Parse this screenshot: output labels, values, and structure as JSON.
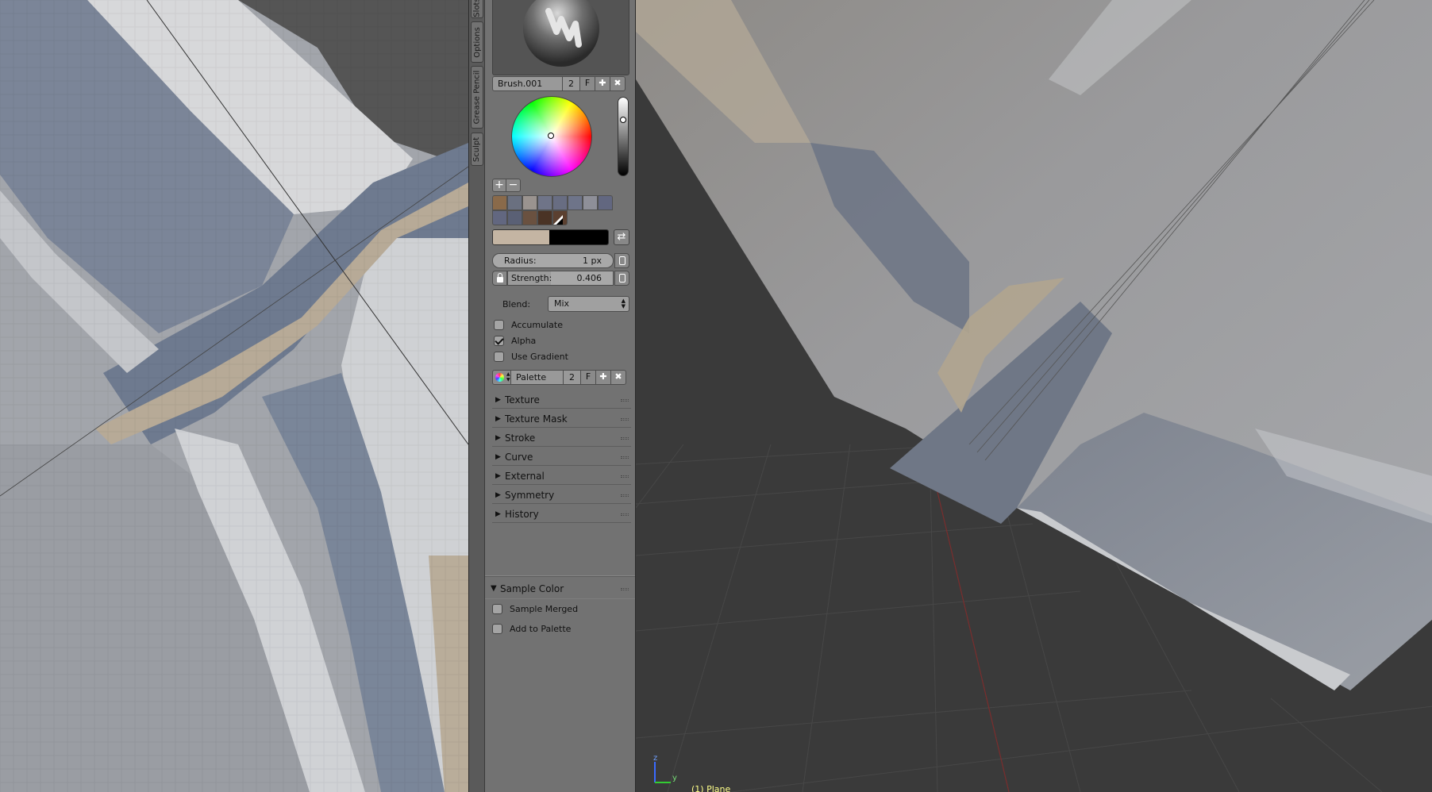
{
  "shelf_tabs": [
    "Slots",
    "Options",
    "Grease Pencil",
    "Sculpt"
  ],
  "brush": {
    "name": "Brush.001",
    "users": "2",
    "fake_user": "F"
  },
  "palette_colors": [
    [
      "#8a6a4a",
      "#6a7080",
      "#9a938f",
      "#6f7488",
      "#686d82",
      "#6e7489",
      "#8e8f98",
      "#626780"
    ],
    [
      "#626780",
      "#5a6075",
      "#6a5140",
      "#4a3325",
      "#5b4030"
    ]
  ],
  "color_field": {
    "primary": "#c4b5a3",
    "secondary": "#000000"
  },
  "radius": {
    "label": "Radius:",
    "value": "1 px",
    "fraction": 0.0
  },
  "strength": {
    "label": "Strength:",
    "value": "0.406",
    "fraction": 0.406
  },
  "blend": {
    "label": "Blend:",
    "value": "Mix"
  },
  "options": [
    {
      "label": "Accumulate",
      "checked": false
    },
    {
      "label": "Alpha",
      "checked": true
    },
    {
      "label": "Use Gradient",
      "checked": false
    }
  ],
  "palette": {
    "name": "Palette",
    "users": "2",
    "fake_user": "F"
  },
  "sections": [
    "Texture",
    "Texture Mask",
    "Stroke",
    "Curve",
    "External",
    "Symmetry",
    "History"
  ],
  "sample_color": {
    "title": "Sample Color",
    "options": [
      {
        "label": "Sample Merged",
        "checked": false
      },
      {
        "label": "Add to Palette",
        "checked": false
      }
    ]
  },
  "viewport": {
    "object_label": "(1) Plane",
    "axis_z": "z",
    "axis_y": "y"
  }
}
